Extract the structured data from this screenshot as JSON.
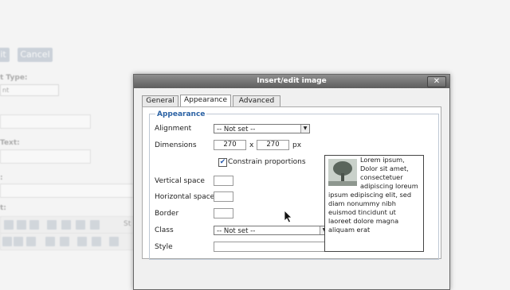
{
  "background": {
    "btn_left": "it",
    "btn_cancel": "Cancel",
    "label_type": "t Type:",
    "select_type": "nt",
    "label_text": "Text:",
    "label_colon": ":",
    "label_t": "t:",
    "toolbar_suffix": "St"
  },
  "dialog": {
    "title": "Insert/edit image",
    "close_glyph": "✕",
    "tabs": [
      "General",
      "Appearance",
      "Advanced"
    ],
    "legend": "Appearance",
    "alignment_label": "Alignment",
    "alignment_value": "-- Not set --",
    "dimensions_label": "Dimensions",
    "width_value": "270",
    "x_sep": "x",
    "height_value": "270",
    "px_unit": "px",
    "constrain_label": "Constrain proportions",
    "constrain_checked": true,
    "vspace_label": "Vertical space",
    "hspace_label": "Horizontal space",
    "border_label": "Border",
    "class_label": "Class",
    "class_value": "-- Not set --",
    "style_label": "Style",
    "preview_text": "Lorem ipsum, Dolor sit amet, consectetuer adipiscing loreum ipsum edipiscing elit, sed diam nonummy nibh euismod tincidunt ut laoreet dolore magna aliquam erat"
  },
  "colors": {
    "accent": "#2b62a4",
    "titlebar": "#6e6e6e"
  }
}
